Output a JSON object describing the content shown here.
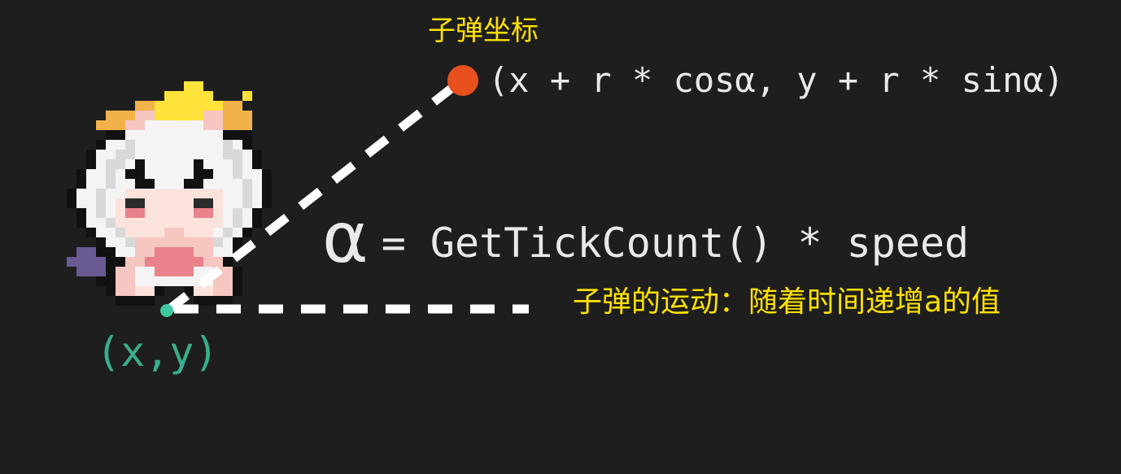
{
  "captions": {
    "bullet_coordinate": "子弹坐标",
    "bullet_motion": "子弹的运动：随着时间递增a的值"
  },
  "formulas": {
    "bullet_position": "(x + r * cosα, y + r * sinα)",
    "alpha_symbol": "α",
    "alpha_rhs": "= GetTickCount() * speed"
  },
  "labels": {
    "origin": "(x,y)"
  },
  "colors": {
    "background": "#1e1e1f",
    "caption": "#ffe100",
    "formula_text": "#e9e9e9",
    "bullet_point": "#e8501e",
    "origin_point": "#3ec8a0",
    "guide_lines": "#ffffff"
  },
  "icons": {
    "character": "pixel-art chibi character with white hair and golden halo"
  }
}
